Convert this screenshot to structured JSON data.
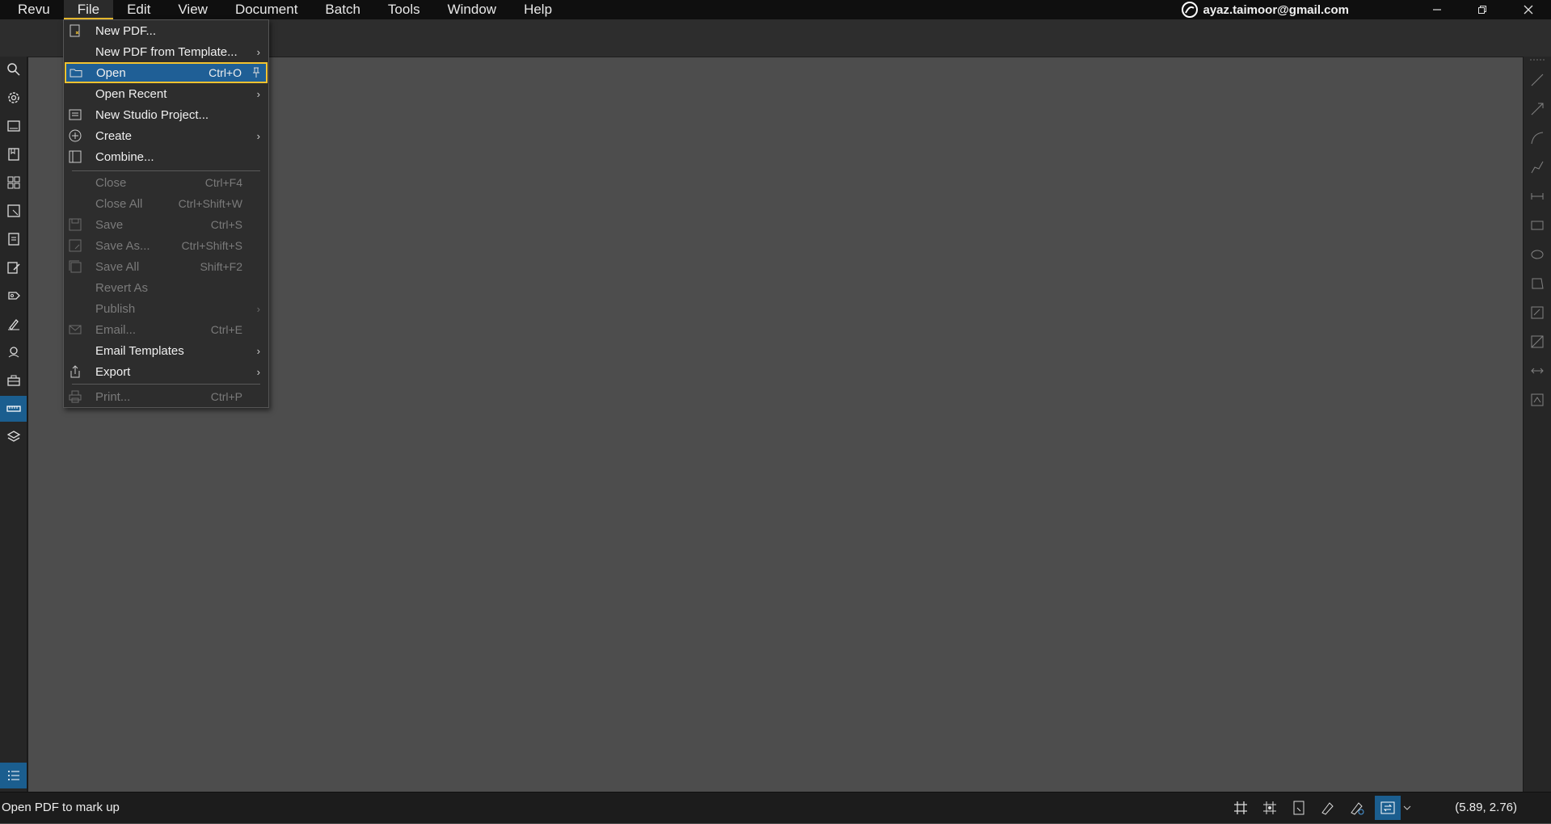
{
  "menubar": {
    "items": [
      "Revu",
      "File",
      "Edit",
      "View",
      "Document",
      "Batch",
      "Tools",
      "Window",
      "Help"
    ],
    "account": "ayaz.taimoor@gmail.com"
  },
  "file_menu": {
    "new_pdf": "New PDF...",
    "new_from_template": "New PDF from Template...",
    "open": "Open",
    "open_sc": "Ctrl+O",
    "open_recent": "Open Recent",
    "new_studio": "New Studio Project...",
    "create": "Create",
    "combine": "Combine...",
    "close": "Close",
    "close_sc": "Ctrl+F4",
    "close_all": "Close All",
    "close_all_sc": "Ctrl+Shift+W",
    "save": "Save",
    "save_sc": "Ctrl+S",
    "save_as": "Save As...",
    "save_as_sc": "Ctrl+Shift+S",
    "save_all": "Save All",
    "save_all_sc": "Shift+F2",
    "revert_as": "Revert As",
    "publish": "Publish",
    "email": "Email...",
    "email_sc": "Ctrl+E",
    "email_templates": "Email Templates",
    "export": "Export",
    "print": "Print...",
    "print_sc": "Ctrl+P"
  },
  "status": {
    "message": "Open PDF to mark up",
    "coords": "(5.89, 2.76)"
  },
  "colors": {
    "accent": "#f2c230",
    "selection": "#1f5f96",
    "canvas": "#4d4d4d"
  }
}
